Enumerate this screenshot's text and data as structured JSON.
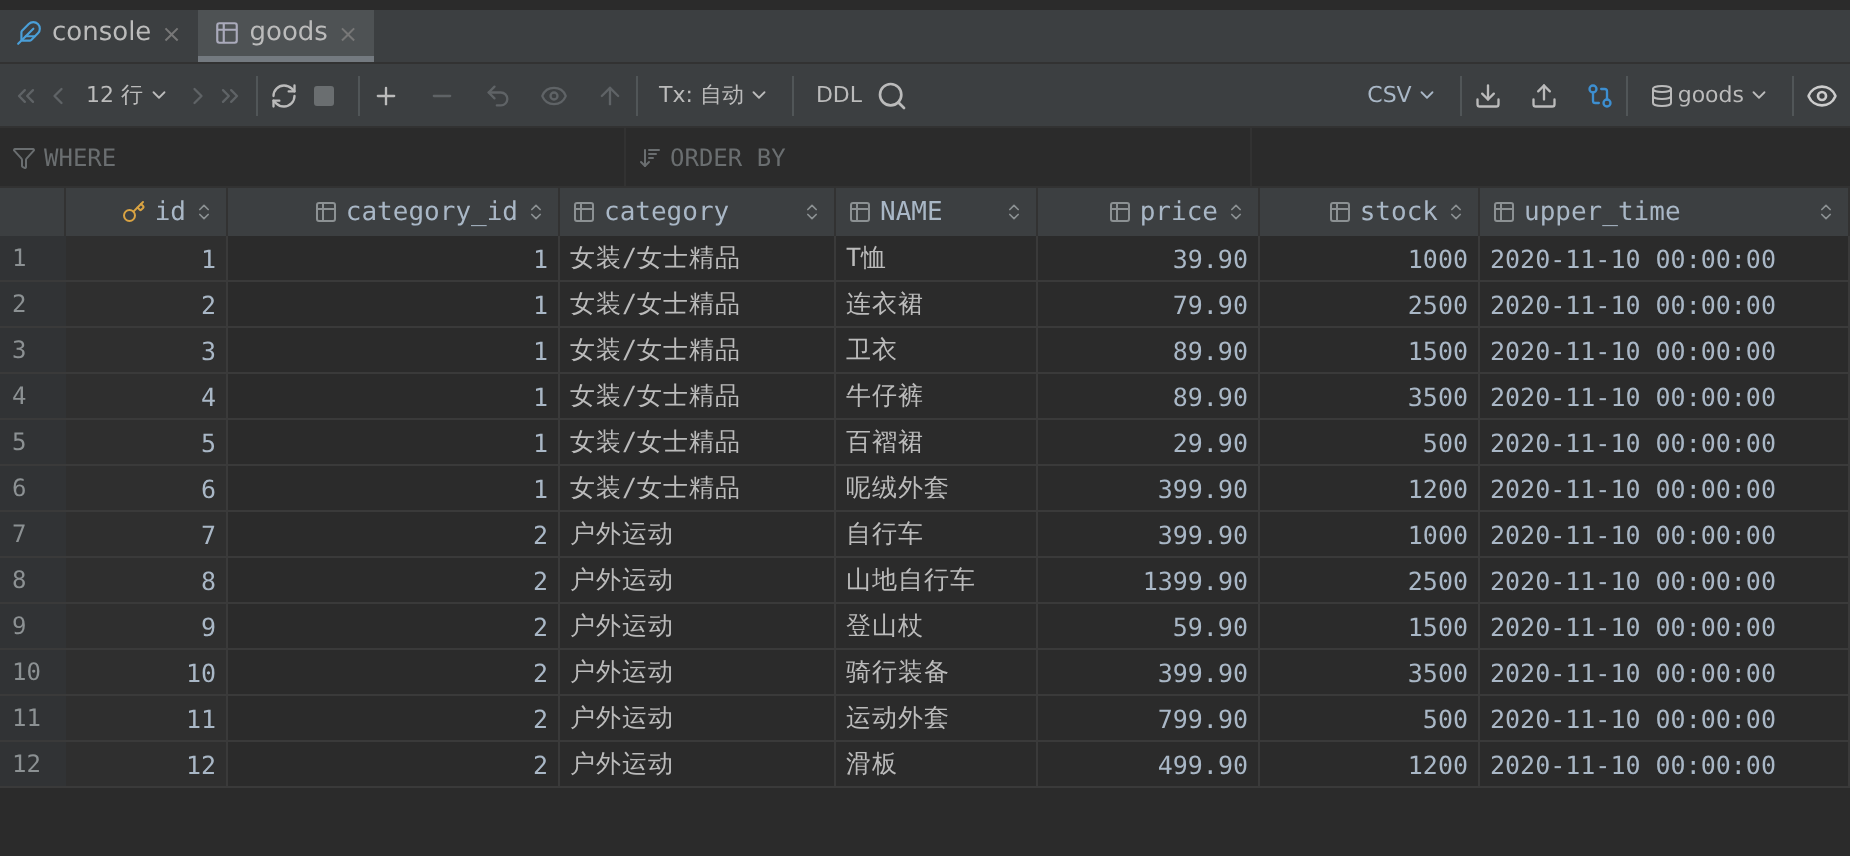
{
  "tabs": [
    {
      "label": "console",
      "kind": "console",
      "selected": false,
      "close": "×"
    },
    {
      "label": "goods",
      "kind": "table",
      "selected": true,
      "close": "×"
    }
  ],
  "toolbar": {
    "rows_label": "12 行",
    "tx_label": "Tx: 自动",
    "ddl_label": "DDL",
    "export_label": "CSV",
    "schema_label": "goods"
  },
  "filter": {
    "where_placeholder": "WHERE",
    "order_placeholder": "ORDER BY"
  },
  "table": {
    "columns": [
      {
        "label": "id",
        "key": true
      },
      {
        "label": "category_id",
        "key": false
      },
      {
        "label": "category",
        "key": false
      },
      {
        "label": "NAME",
        "key": false
      },
      {
        "label": "price",
        "key": false
      },
      {
        "label": "stock",
        "key": false
      },
      {
        "label": "upper_time",
        "key": false
      }
    ],
    "rows": [
      {
        "num": "1",
        "cells": [
          "1",
          "1",
          "女装/女士精品",
          "T恤",
          "39.90",
          "1000",
          "2020-11-10 00:00:00"
        ]
      },
      {
        "num": "2",
        "cells": [
          "2",
          "1",
          "女装/女士精品",
          "连衣裙",
          "79.90",
          "2500",
          "2020-11-10 00:00:00"
        ]
      },
      {
        "num": "3",
        "cells": [
          "3",
          "1",
          "女装/女士精品",
          "卫衣",
          "89.90",
          "1500",
          "2020-11-10 00:00:00"
        ]
      },
      {
        "num": "4",
        "cells": [
          "4",
          "1",
          "女装/女士精品",
          "牛仔裤",
          "89.90",
          "3500",
          "2020-11-10 00:00:00"
        ]
      },
      {
        "num": "5",
        "cells": [
          "5",
          "1",
          "女装/女士精品",
          "百褶裙",
          "29.90",
          "500",
          "2020-11-10 00:00:00"
        ]
      },
      {
        "num": "6",
        "cells": [
          "6",
          "1",
          "女装/女士精品",
          "呢绒外套",
          "399.90",
          "1200",
          "2020-11-10 00:00:00"
        ]
      },
      {
        "num": "7",
        "cells": [
          "7",
          "2",
          "户外运动",
          "自行车",
          "399.90",
          "1000",
          "2020-11-10 00:00:00"
        ]
      },
      {
        "num": "8",
        "cells": [
          "8",
          "2",
          "户外运动",
          "山地自行车",
          "1399.90",
          "2500",
          "2020-11-10 00:00:00"
        ]
      },
      {
        "num": "9",
        "cells": [
          "9",
          "2",
          "户外运动",
          "登山杖",
          "59.90",
          "1500",
          "2020-11-10 00:00:00"
        ]
      },
      {
        "num": "10",
        "cells": [
          "10",
          "2",
          "户外运动",
          "骑行装备",
          "399.90",
          "3500",
          "2020-11-10 00:00:00"
        ]
      },
      {
        "num": "11",
        "cells": [
          "11",
          "2",
          "户外运动",
          "运动外套",
          "799.90",
          "500",
          "2020-11-10 00:00:00"
        ]
      },
      {
        "num": "12",
        "cells": [
          "12",
          "2",
          "户外运动",
          "滑板",
          "499.90",
          "1200",
          "2020-11-10 00:00:00"
        ]
      }
    ]
  }
}
